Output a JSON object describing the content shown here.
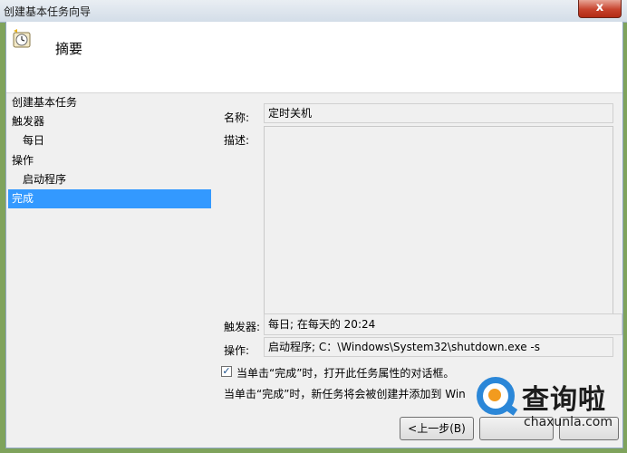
{
  "window": {
    "title": "创建基本任务向导",
    "close_glyph": "x"
  },
  "header": {
    "title": "摘要",
    "icon": "task-clock-icon"
  },
  "sidebar": {
    "items": [
      {
        "label": "创建基本任务"
      },
      {
        "label": "触发器"
      },
      {
        "label": "每日"
      },
      {
        "label": "操作"
      },
      {
        "label": "启动程序"
      },
      {
        "label": "完成"
      }
    ]
  },
  "summary": {
    "name_label": "名称:",
    "name_value": "定时关机",
    "description_label": "描述:",
    "description_value": "",
    "trigger_label": "触发器:",
    "trigger_value": "每日; 在每天的 20:24",
    "action_label": "操作:",
    "action_value": "启动程序; C：\\Windows\\System32\\shutdown.exe -s"
  },
  "options": {
    "open_properties_label": "当单击“完成”时，打开此任务属性的对话框。",
    "open_properties_checked": true,
    "note": "当单击“完成”时，新任务将会被创建并添加到 Win"
  },
  "buttons": {
    "back_label": "<上一步(B)"
  },
  "watermark": {
    "text_cn": "查询啦",
    "text_en": "chaxunla.com",
    "icon": "magnifier-logo-icon"
  },
  "colors": {
    "selected": "#3399ff",
    "close": "#c7432d",
    "logo_blue": "#2b87d8",
    "logo_orange": "#f29b1f"
  }
}
